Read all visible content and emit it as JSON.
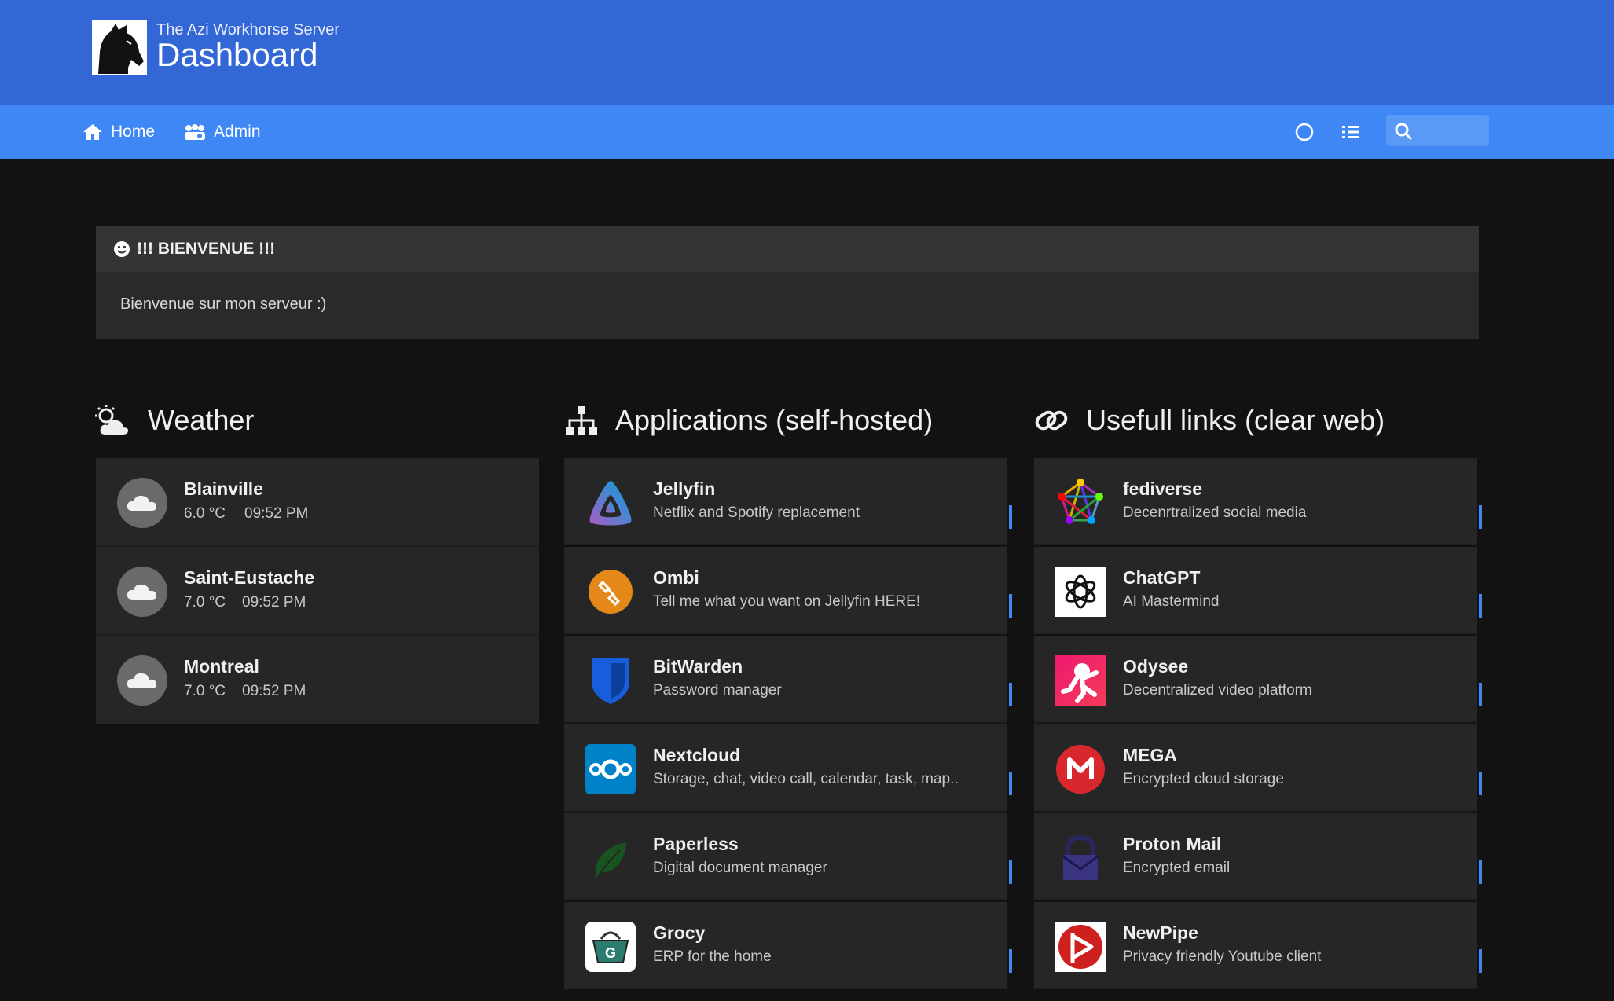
{
  "header": {
    "subtitle": "The Azi Workhorse Server",
    "title": "Dashboard"
  },
  "nav": {
    "home": "Home",
    "admin": "Admin",
    "search_placeholder": ""
  },
  "message": {
    "title": "!!! BIENVENUE !!!",
    "body": "Bienvenue sur mon serveur :)"
  },
  "columns": {
    "weather": "Weather",
    "apps": "Applications (self-hosted)",
    "links": "Usefull links (clear web)"
  },
  "weather": [
    {
      "city": "Blainville",
      "temp": "6.0 °C",
      "time": "09:52 PM"
    },
    {
      "city": "Saint-Eustache",
      "temp": "7.0 °C",
      "time": "09:52 PM"
    },
    {
      "city": "Montreal",
      "temp": "7.0 °C",
      "time": "09:52 PM"
    }
  ],
  "apps": [
    {
      "name": "Jellyfin",
      "desc": "Netflix and Spotify replacement",
      "icon": "jellyfin-icon"
    },
    {
      "name": "Ombi",
      "desc": "Tell me what you want on Jellyfin HERE!",
      "icon": "ombi-icon"
    },
    {
      "name": "BitWarden",
      "desc": "Password manager",
      "icon": "bitwarden-icon"
    },
    {
      "name": "Nextcloud",
      "desc": "Storage, chat, video call, calendar, task, map..",
      "icon": "nextcloud-icon"
    },
    {
      "name": "Paperless",
      "desc": "Digital document manager",
      "icon": "paperless-icon"
    },
    {
      "name": "Grocy",
      "desc": "ERP for the home",
      "icon": "grocy-icon"
    }
  ],
  "links": [
    {
      "name": "fediverse",
      "desc": "Decenrtralized social media",
      "icon": "fediverse-icon"
    },
    {
      "name": "ChatGPT",
      "desc": "AI Mastermind",
      "icon": "chatgpt-icon"
    },
    {
      "name": "Odysee",
      "desc": "Decentralized video platform",
      "icon": "odysee-icon"
    },
    {
      "name": "MEGA",
      "desc": "Encrypted cloud storage",
      "icon": "mega-icon"
    },
    {
      "name": "Proton Mail",
      "desc": "Encrypted email",
      "icon": "proton-mail-icon"
    },
    {
      "name": "NewPipe",
      "desc": "Privacy friendly Youtube client",
      "icon": "newpipe-icon"
    }
  ],
  "colors": {
    "header": "#3367d6",
    "navbar": "#3f87f5",
    "background": "#121212",
    "card": "#262626"
  }
}
